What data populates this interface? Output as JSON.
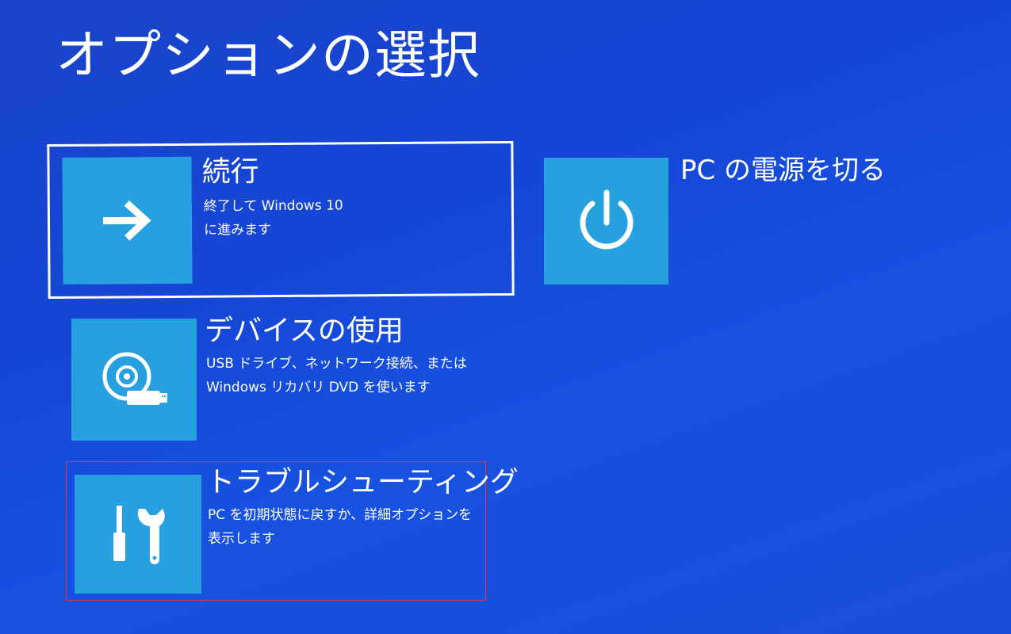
{
  "page": {
    "title": "オプションの選択"
  },
  "colors": {
    "background": "#1a4fd8",
    "tile": "#26a0de",
    "focus_border": "#ffffff",
    "highlight_border": "#e2344a"
  },
  "options": [
    {
      "id": "continue",
      "title": "続行",
      "desc_line1": "終了して Windows 10",
      "desc_line2": "に進みます",
      "icon": "arrow-right-icon"
    },
    {
      "id": "power-off",
      "title": "PC の電源を切る",
      "icon": "power-icon"
    },
    {
      "id": "use-device",
      "title": "デバイスの使用",
      "desc_line1": "USB ドライブ、ネットワーク接続、または",
      "desc_line2": "Windows リカバリ DVD を使います",
      "icon": "disc-usb-icon"
    },
    {
      "id": "troubleshoot",
      "title": "トラブルシューティング",
      "desc_line1": "PC を初期状態に戻すか、詳細オプションを",
      "desc_line2": "表示します",
      "icon": "tools-icon"
    }
  ]
}
